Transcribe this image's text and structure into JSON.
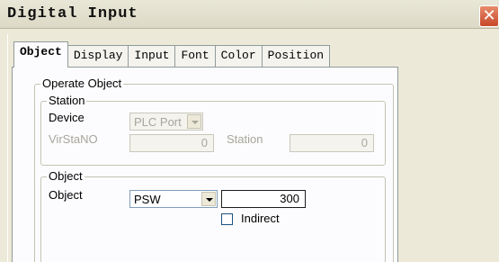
{
  "window": {
    "title": "Digital Input"
  },
  "tabs": [
    "Object",
    "Display",
    "Input",
    "Font",
    "Color",
    "Position"
  ],
  "operate_object": {
    "legend": "Operate Object",
    "station": {
      "legend": "Station",
      "device_label": "Device",
      "device_value": "PLC Port",
      "virstano_label": "VirStaNO",
      "virstano_value": "0",
      "station_label": "Station",
      "station_value": "0"
    },
    "object": {
      "legend": "Object",
      "object_label": "Object",
      "object_type": "PSW",
      "object_address": "300",
      "indirect_label": "Indirect",
      "indirect_checked": false
    }
  },
  "icons": {
    "close": "close-icon",
    "dropdown": "chevron-down-icon"
  }
}
